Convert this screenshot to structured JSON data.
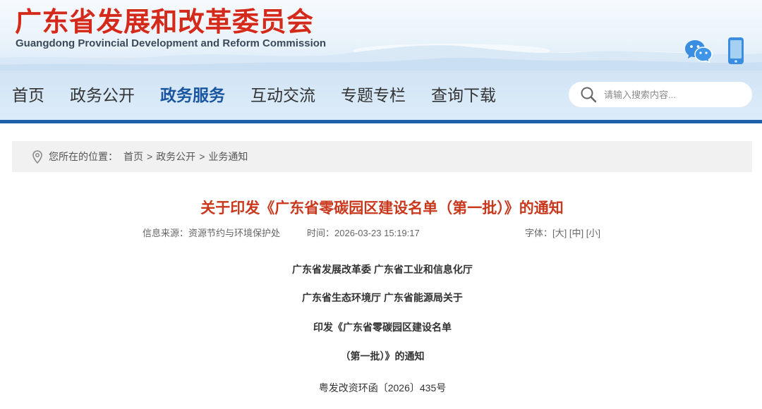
{
  "header": {
    "title": "广东省发展和改革委员会",
    "subtitle": "Guangdong Provincial Development and Reform Commission",
    "wechat_icon": "wechat-icon",
    "mobile_icon": "mobile-phone-icon"
  },
  "nav": {
    "items": [
      {
        "label": "首页",
        "active": false
      },
      {
        "label": "政务公开",
        "active": false
      },
      {
        "label": "政务服务",
        "active": true
      },
      {
        "label": "互动交流",
        "active": false
      },
      {
        "label": "专题专栏",
        "active": false
      },
      {
        "label": "查询下载",
        "active": false
      }
    ],
    "search": {
      "placeholder": "请输入搜索内容...",
      "value": "",
      "icon": "search-icon"
    }
  },
  "breadcrumb": {
    "icon": "location-pin-icon",
    "prefix": "您所在的位置：",
    "separator": ">",
    "items": [
      "首页",
      "政务公开",
      "业务通知"
    ]
  },
  "article": {
    "title": "关于印发《广东省零碳园区建设名单（第一批）》的通知",
    "meta": {
      "source_label": "信息来源：",
      "source": "资源节约与环境保护处",
      "time_label": "时间：",
      "time": "2026-03-23 15:19:17",
      "font_label": "字体：",
      "font_sizes": [
        "[大]",
        "[中]",
        "[小]"
      ]
    },
    "heading_lines": [
      "广东省发展改革委 广东省工业和信息化厅",
      "广东省生态环境厅 广东省能源局关于",
      "印发《广东省零碳园区建设名单",
      "（第一批）》的通知"
    ],
    "doc_number": "粤发改资环函〔2026〕435号"
  },
  "colors": {
    "brand_red": "#d42a1c",
    "title_red": "#c9381d",
    "nav_active": "#1a56a0",
    "nav_bar": "#1d5fab",
    "breadcrumb_bg": "#f1f1f1"
  }
}
